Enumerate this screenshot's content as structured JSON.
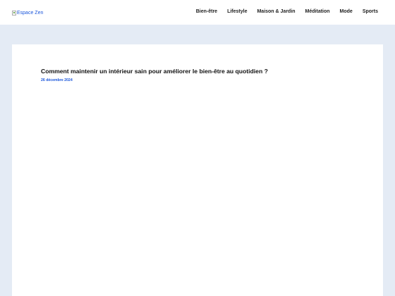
{
  "header": {
    "logo_alt": "Espace Zen",
    "nav": [
      {
        "label": "Bien-être"
      },
      {
        "label": "Lifestyle"
      },
      {
        "label": "Maison & Jardin"
      },
      {
        "label": "Méditation"
      },
      {
        "label": "Mode"
      },
      {
        "label": "Sports"
      }
    ]
  },
  "article": {
    "title": "Comment maintenir un intérieur sain pour améliorer le bien-être au quotidien ?",
    "date": "26 décembre 2024"
  },
  "colors": {
    "page_background": "#e4ebf5",
    "accent": "#1a56db",
    "text": "#111111"
  }
}
